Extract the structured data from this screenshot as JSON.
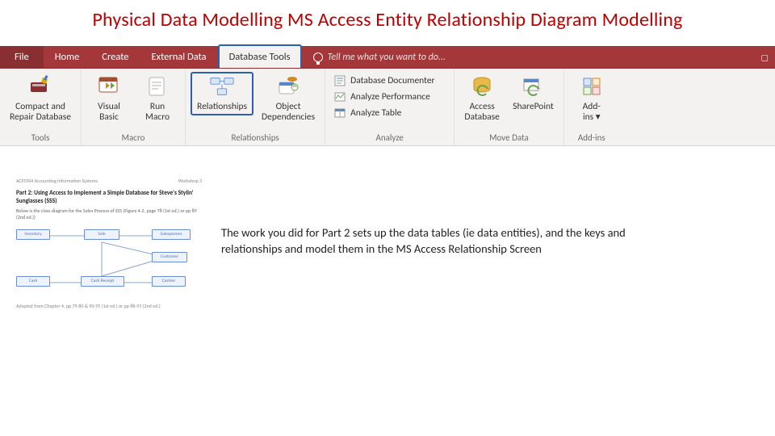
{
  "slide": {
    "title": "Physical Data Modelling MS Access Entity Relationship Diagram Modelling"
  },
  "ribbon": {
    "tabs": {
      "file": "File",
      "home": "Home",
      "create": "Create",
      "external_data": "External Data",
      "database_tools": "Database Tools"
    },
    "tellme": "Tell me what you want to do...",
    "groups": {
      "tools": {
        "label": "Tools",
        "compact_repair": "Compact and\nRepair Database"
      },
      "macro": {
        "label": "Macro",
        "visual_basic": "Visual\nBasic",
        "run_macro": "Run\nMacro"
      },
      "relationships": {
        "label": "Relationships",
        "relationships_btn": "Relationships",
        "object_deps": "Object\nDependencies"
      },
      "analyze": {
        "label": "Analyze",
        "documenter": "Database Documenter",
        "perf": "Analyze Performance",
        "table": "Analyze Table"
      },
      "movedata": {
        "label": "Move Data",
        "access": "Access\nDatabase",
        "sharepoint": "SharePoint"
      },
      "addins": {
        "label": "Add-ins",
        "addins_btn": "Add-\nins ▾"
      }
    }
  },
  "thumb": {
    "course": "ACFS904 Accounting Information Systems",
    "workshop": "Workshop 3",
    "title": "Part 2: Using Access to Implement a Simple Database for Steve's Stylin' Sunglasses (SSS)",
    "subtitle": "Below is the class diagram for the Sales Process of SSS (Figure 4-2, page 78 (1st ed.) or pp 89 (2nd ed.))",
    "footer": "Adapted from Chapter 4, pp 75-80 & 90-95 (1st ed.) or pp 88-93 (2nd ed.)",
    "entities": {
      "inventory": "Inventory",
      "sale": "Sale",
      "salesperson": "Salesperson",
      "customer": "Customer",
      "cash": "Cash",
      "cash_receipt": "Cash Receipt",
      "cashier": "Cashier"
    }
  },
  "body": {
    "text": "The work you did for Part 2 sets up the data tables (ie data entities), and the keys and relationships and model them in the MS Access Relationship Screen"
  }
}
